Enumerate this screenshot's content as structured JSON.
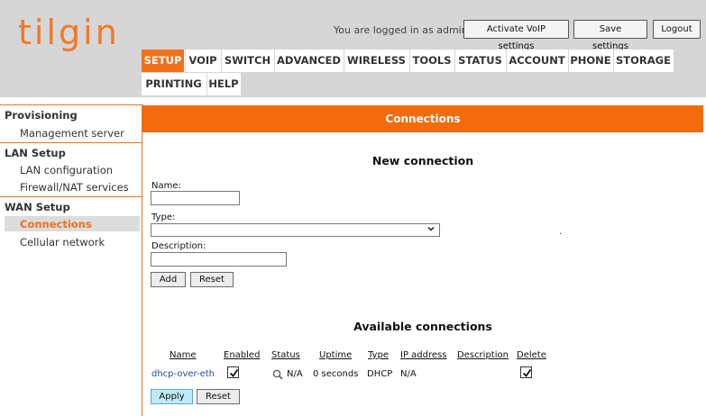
{
  "header": {
    "logo_text": "tilgin",
    "logged_in_text": "You are logged in as admin.",
    "buttons": {
      "activate_voip": "Activate VoIP settings",
      "save_settings": "Save settings",
      "logout": "Logout"
    },
    "nav_tabs": [
      "SETUP",
      "VOIP",
      "SWITCH",
      "ADVANCED",
      "WIRELESS",
      "TOOLS",
      "STATUS",
      "ACCOUNT",
      "PHONE",
      "STORAGE",
      "PRINTING",
      "HELP"
    ],
    "active_tab": "SETUP",
    "accent_color": "#f2711c"
  },
  "sidebar": {
    "sections": [
      {
        "title": "Provisioning",
        "items": [
          "Management server"
        ]
      },
      {
        "title": "LAN Setup",
        "items": [
          "LAN configuration",
          "Firewall/NAT services"
        ]
      },
      {
        "title": "WAN Setup",
        "items": [
          "Connections",
          "Cellular network"
        ]
      }
    ],
    "active_item": "Connections"
  },
  "main": {
    "title": "Connections",
    "new_connection": {
      "heading": "New connection",
      "name_label": "Name:",
      "name_value": "",
      "type_label": "Type:",
      "type_value": "",
      "description_label": "Description:",
      "description_value": "",
      "add_button": "Add",
      "reset_button": "Reset",
      "dot": "."
    },
    "available": {
      "heading": "Available connections",
      "columns": [
        "Name",
        "Enabled",
        "Status",
        "Uptime",
        "Type",
        "IP address",
        "Description",
        "Delete"
      ],
      "rows": [
        {
          "name": "dhcp-over-eth",
          "enabled": true,
          "status": "N/A",
          "uptime": "0 seconds",
          "type": "DHCP",
          "ip_address": "N/A",
          "description": "",
          "delete": true
        }
      ],
      "apply_button": "Apply",
      "reset_button": "Reset"
    }
  }
}
